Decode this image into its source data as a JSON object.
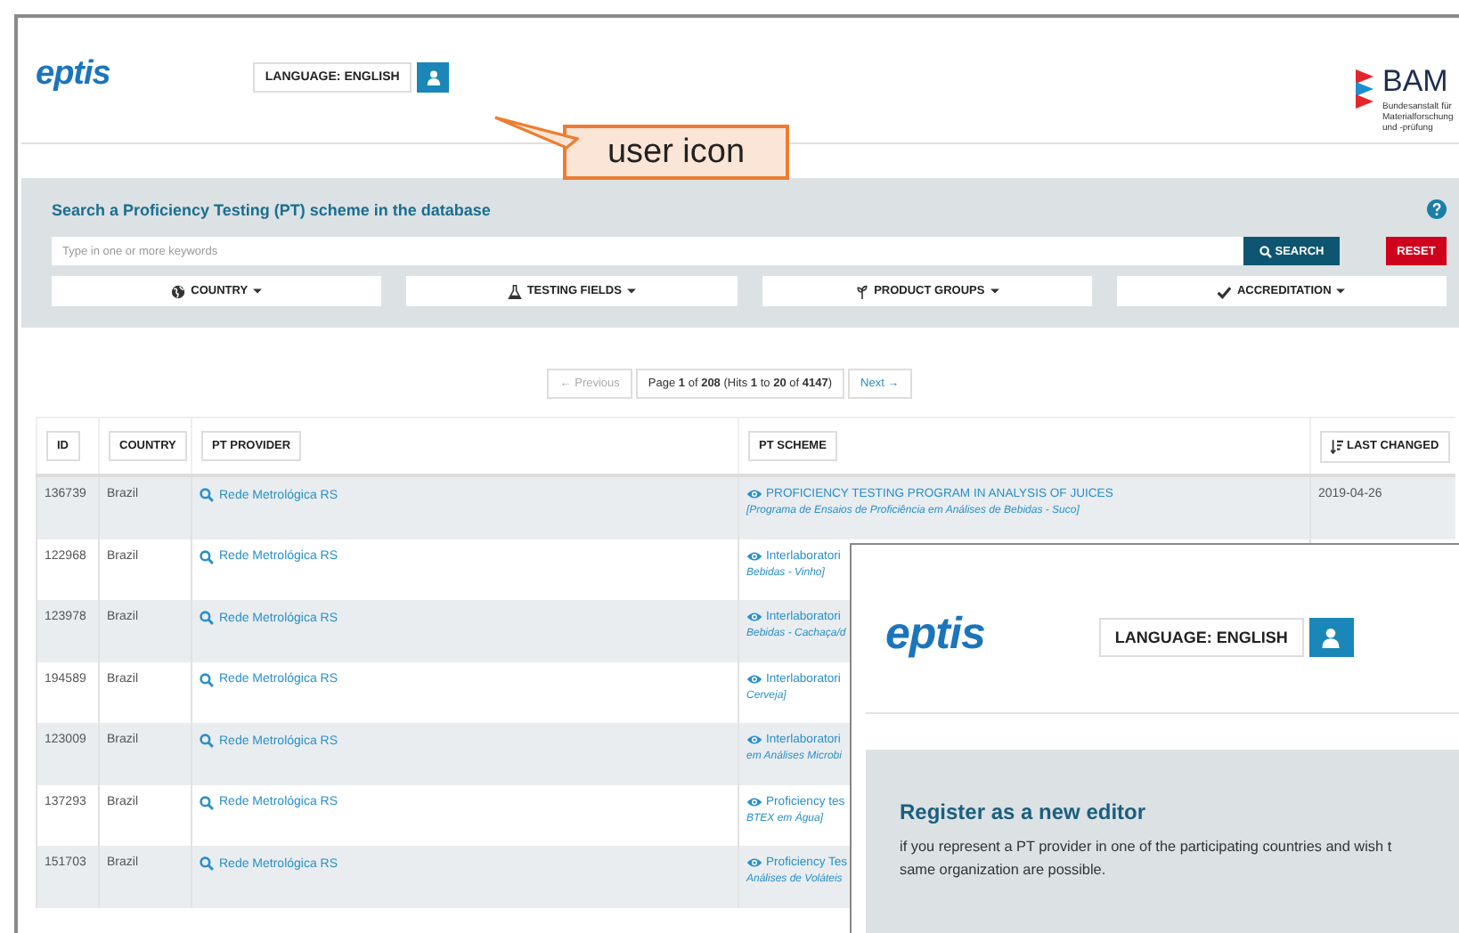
{
  "header": {
    "logo": "eptis",
    "language_button": "LANGUAGE: ENGLISH",
    "partner_logo": {
      "name": "BAM",
      "lines": [
        "Bundesanstalt für",
        "Materialforschung",
        "und -prüfung"
      ]
    }
  },
  "callout": {
    "text": "user icon"
  },
  "search": {
    "title": "Search a Proficiency Testing (PT) scheme in the database",
    "placeholder": "Type in one or more keywords",
    "search_button": "SEARCH",
    "reset_button": "RESET",
    "filters": [
      {
        "kind": "country",
        "label": "COUNTRY"
      },
      {
        "kind": "testing",
        "label": "TESTING FIELDS"
      },
      {
        "kind": "product",
        "label": "PRODUCT GROUPS"
      },
      {
        "kind": "accreditation",
        "label": "ACCREDITATION"
      }
    ]
  },
  "pagination": {
    "previous": {
      "label": "← Previous",
      "disabled": true
    },
    "info": "Page **1** of **208** (Hits **1** to **20** of **4147**)",
    "next": {
      "label": "Next →",
      "disabled": false
    }
  },
  "table": {
    "columns": [
      {
        "label": "ID",
        "sorted": false
      },
      {
        "label": "COUNTRY",
        "sorted": false
      },
      {
        "label": "PT PROVIDER",
        "sorted": false
      },
      {
        "label": "PT SCHEME",
        "sorted": false
      },
      {
        "label": "LAST CHANGED",
        "sorted": true
      }
    ],
    "rows": [
      {
        "id": "136739",
        "country": "Brazil",
        "provider": "Rede Metrológica RS",
        "scheme_title": "PROFICIENCY TESTING PROGRAM IN ANALYSIS OF JUICES",
        "scheme_subtitle": "[Programa de Ensaios de Proficiência em Análises de Bebidas - Suco]",
        "last_changed": "2019-04-26"
      },
      {
        "id": "122968",
        "country": "Brazil",
        "provider": "Rede Metrológica RS",
        "scheme_title": "Interlaboratori",
        "scheme_subtitle": "Bebidas - Vinho]"
      },
      {
        "id": "123978",
        "country": "Brazil",
        "provider": "Rede Metrológica RS",
        "scheme_title": "Interlaboratori",
        "scheme_subtitle": "Bebidas - Cachaça/d"
      },
      {
        "id": "194589",
        "country": "Brazil",
        "provider": "Rede Metrológica RS",
        "scheme_title": "Interlaboratori",
        "scheme_subtitle": "Cerveja]"
      },
      {
        "id": "123009",
        "country": "Brazil",
        "provider": "Rede Metrológica RS",
        "scheme_title": "Interlaboratori",
        "scheme_subtitle": "em Análises Microbi"
      },
      {
        "id": "137293",
        "country": "Brazil",
        "provider": "Rede Metrológica RS",
        "scheme_title": "Proficiency tes",
        "scheme_subtitle": "BTEX em Água]"
      },
      {
        "id": "151703",
        "country": "Brazil",
        "provider": "Rede Metrológica RS",
        "scheme_title": "Proficiency Tes",
        "scheme_subtitle": "Análises de Voláteis"
      }
    ]
  },
  "overlay": {
    "logo": "eptis",
    "language_button": "LANGUAGE: ENGLISH",
    "heading": "Register as a new editor",
    "text_lines": [
      "if you represent a PT provider in one of the participating countries and wish t",
      "same organization are possible."
    ]
  }
}
